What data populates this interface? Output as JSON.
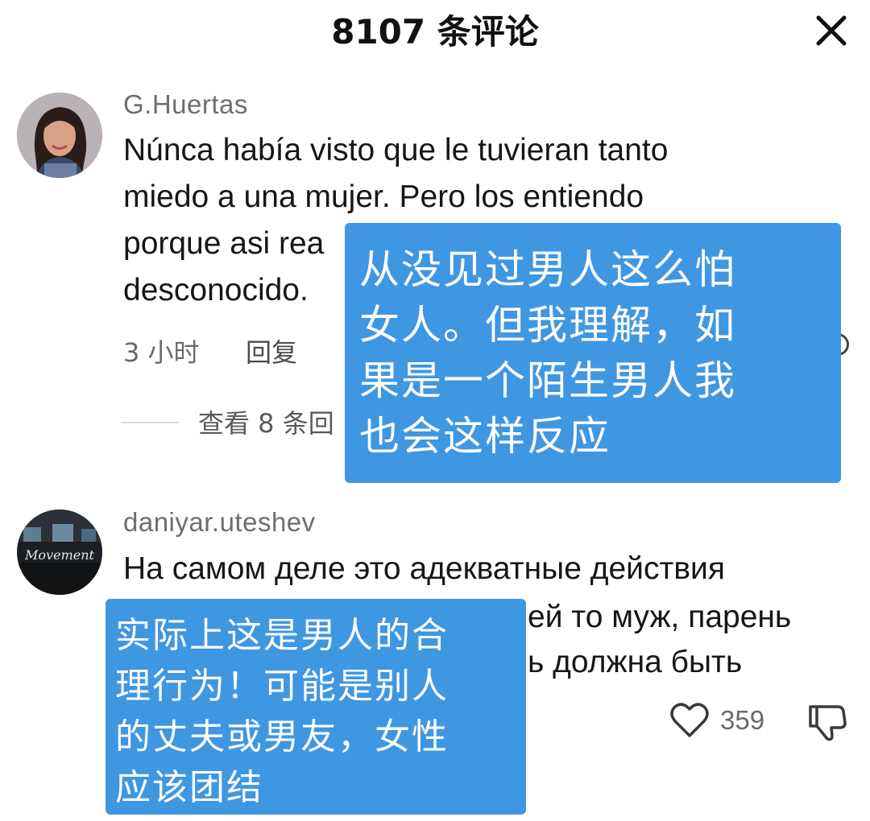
{
  "header": {
    "title": "8107 条评论",
    "close_icon": "close-icon"
  },
  "comments": [
    {
      "username": "G.Huertas",
      "avatar_icon": "avatar-woman",
      "text_lines": [
        "Núnca había visto que le tuvieran tanto",
        "miedo a una mujer. Pero los entiendo",
        "porque asi rea",
        "desconocido."
      ],
      "time": "3 小时",
      "reply_label": "回复",
      "view_replies": "查看 8 条回"
    },
    {
      "username": "daniyar.uteshev",
      "avatar_icon": "avatar-movement",
      "avatar_text": "Movement",
      "text_lines": [
        "На самом деле это адекватные действия",
        "ей то муж, парень",
        "ь должна быть"
      ],
      "like_count": "359",
      "like_icon": "heart-icon",
      "dislike_icon": "thumbs-down-icon"
    }
  ],
  "overlays": [
    {
      "lines": [
        "从没见过男人这么怕",
        "女人。但我理解，如",
        "果是一个陌生男人我",
        "也会这样反应"
      ]
    },
    {
      "lines": [
        "实际上这是男人的合",
        "理行为！可能是别人",
        "的丈夫或男友，女性",
        "应该团结"
      ]
    }
  ],
  "colors": {
    "overlay_bg": "#3f97e2",
    "username": "#6e6e6e",
    "text": "#161616"
  }
}
